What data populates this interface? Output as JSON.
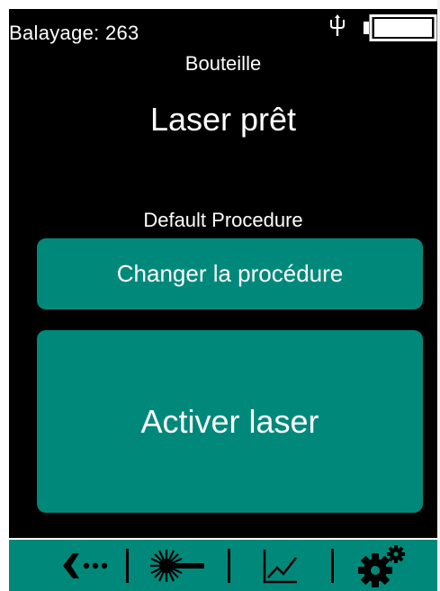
{
  "status_bar": {
    "scan_count_label": "Balayage: 263",
    "usb_icon": "usb-icon",
    "battery_icon": "battery-icon",
    "battery_level": 1.0
  },
  "main": {
    "sample_type": "Bouteille",
    "status_title": "Laser prêt",
    "procedure_name": "Default Procedure",
    "change_procedure_label": "Changer la procédure",
    "activate_laser_label": "Activer laser"
  },
  "toolbar": {
    "items": [
      {
        "icon": "back-arrow-icon"
      },
      {
        "icon": "laser-icon"
      },
      {
        "icon": "chart-icon"
      },
      {
        "icon": "settings-gears-icon"
      }
    ]
  },
  "colors": {
    "screen_bg": "#000000",
    "accent": "#00897b",
    "text": "#ffffff"
  }
}
